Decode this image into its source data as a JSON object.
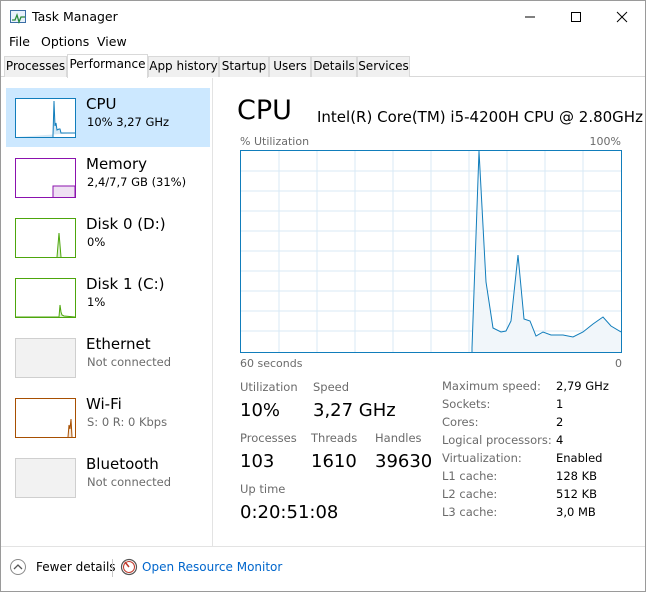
{
  "window": {
    "title": "Task Manager",
    "icons": {
      "app": "task-manager-icon",
      "minimize": "minimize-icon",
      "maximize": "maximize-icon",
      "close": "close-icon"
    }
  },
  "menu": [
    "File",
    "Options",
    "View"
  ],
  "tabs": [
    {
      "label": "Processes",
      "active": false
    },
    {
      "label": "Performance",
      "active": true
    },
    {
      "label": "App history",
      "active": false
    },
    {
      "label": "Startup",
      "active": false
    },
    {
      "label": "Users",
      "active": false
    },
    {
      "label": "Details",
      "active": false
    },
    {
      "label": "Services",
      "active": false
    }
  ],
  "sidebar": [
    {
      "title": "CPU",
      "sub": "10% 3,27 GHz",
      "selected": true,
      "color": "#117dbb"
    },
    {
      "title": "Memory",
      "sub": "2,4/7,7 GB (31%)",
      "selected": false,
      "color": "#8b12ae"
    },
    {
      "title": "Disk 0 (D:)",
      "sub": "0%",
      "selected": false,
      "color": "#4da60c"
    },
    {
      "title": "Disk 1 (C:)",
      "sub": "1%",
      "selected": false,
      "color": "#4da60c"
    },
    {
      "title": "Ethernet",
      "sub": "Not connected",
      "selected": false,
      "color": "#cfcfcf"
    },
    {
      "title": "Wi-Fi",
      "sub": "S: 0 R: 0 Kbps",
      "selected": false,
      "color": "#a74f01"
    },
    {
      "title": "Bluetooth",
      "sub": "Not connected",
      "selected": false,
      "color": "#cfcfcf"
    }
  ],
  "main": {
    "title": "CPU",
    "model": "Intel(R) Core(TM) i5-4200H CPU @ 2.80GHz",
    "graph": {
      "y_label": "% Utilization",
      "y_max_label": "100%",
      "x_left_label": "60 seconds",
      "x_right_label": "0",
      "line_color": "#117dbb"
    },
    "stats": {
      "utilization_label": "Utilization",
      "utilization_value": "10%",
      "speed_label": "Speed",
      "speed_value": "3,27 GHz",
      "processes_label": "Processes",
      "processes_value": "103",
      "threads_label": "Threads",
      "threads_value": "1610",
      "handles_label": "Handles",
      "handles_value": "39630",
      "uptime_label": "Up time",
      "uptime_value": "0:20:51:08"
    },
    "specs": [
      {
        "label": "Maximum speed:",
        "value": "2,79 GHz"
      },
      {
        "label": "Sockets:",
        "value": "1"
      },
      {
        "label": "Cores:",
        "value": "2"
      },
      {
        "label": "Logical processors:",
        "value": "4"
      },
      {
        "label": "Virtualization:",
        "value": "Enabled"
      },
      {
        "label": "L1 cache:",
        "value": "128 KB"
      },
      {
        "label": "L2 cache:",
        "value": "512 KB"
      },
      {
        "label": "L3 cache:",
        "value": "3,0 MB"
      }
    ]
  },
  "footer": {
    "fewer_details": "Fewer details",
    "open_resource_monitor": "Open Resource Monitor",
    "icons": {
      "fewer": "chevron-up-icon",
      "resource": "resource-monitor-icon"
    }
  }
}
